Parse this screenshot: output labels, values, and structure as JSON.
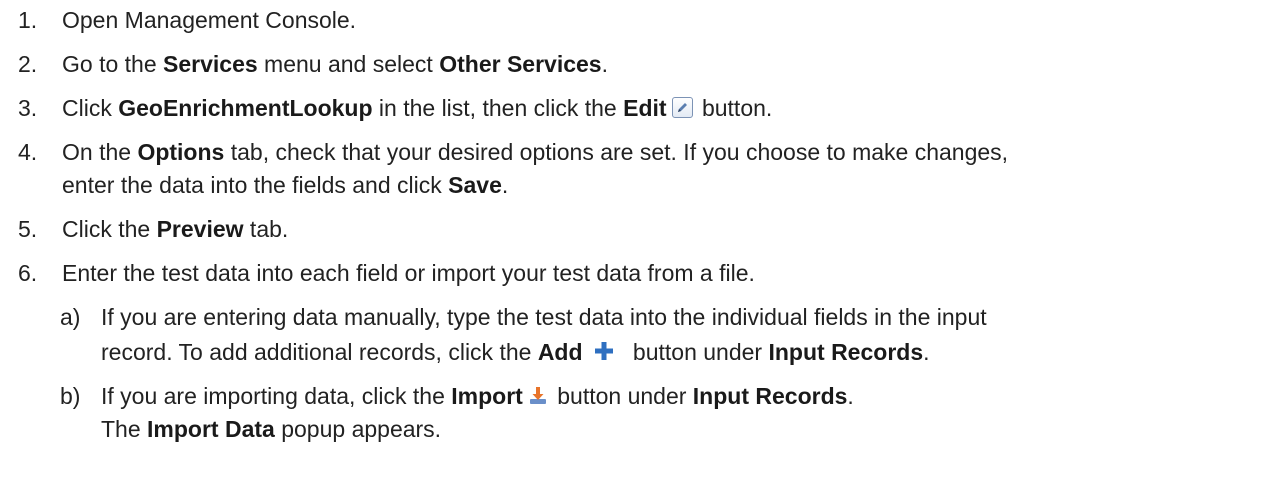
{
  "steps": [
    {
      "num": "1.",
      "text": "Open Management Console."
    },
    {
      "num": "2.",
      "t1": "Go to the ",
      "b1": "Services",
      "t2": " menu and select ",
      "b2": "Other Services",
      "t3": "."
    },
    {
      "num": "3.",
      "t1": "Click ",
      "b1": "GeoEnrichmentLookup",
      "t2": " in the list, then click the ",
      "b2": "Edit",
      "t3": " button."
    },
    {
      "num": "4.",
      "t1": "On the ",
      "b1": "Options",
      "t2": " tab, check that your desired options are set. If you choose to make changes,",
      "line2": "enter the data into the fields and click ",
      "b2": "Save",
      "t3": "."
    },
    {
      "num": "5.",
      "t1": "Click the ",
      "b1": "Preview",
      "t2": " tab."
    },
    {
      "num": "6.",
      "text": "Enter the test data into each field or import your test data from a file."
    }
  ],
  "substeps": [
    {
      "num": "a)",
      "line1": "If you are entering data manually, type the test data into the individual fields in the input",
      "t1": "record. To add additional records, click the ",
      "b1": "Add",
      "t2": " button under ",
      "b2": "Input Records",
      "t3": "."
    },
    {
      "num": "b)",
      "t1": "If you are importing data, click the ",
      "b1": "Import",
      "t2": " button under ",
      "b2": "Input Records",
      "t3": ".",
      "l2a": "The ",
      "l2b": "Import Data",
      "l2c": " popup appears."
    }
  ],
  "icons": {
    "edit": "pencil-icon",
    "add": "plus-icon",
    "import": "import-icon",
    "plus_color": "#2e6fc0"
  }
}
